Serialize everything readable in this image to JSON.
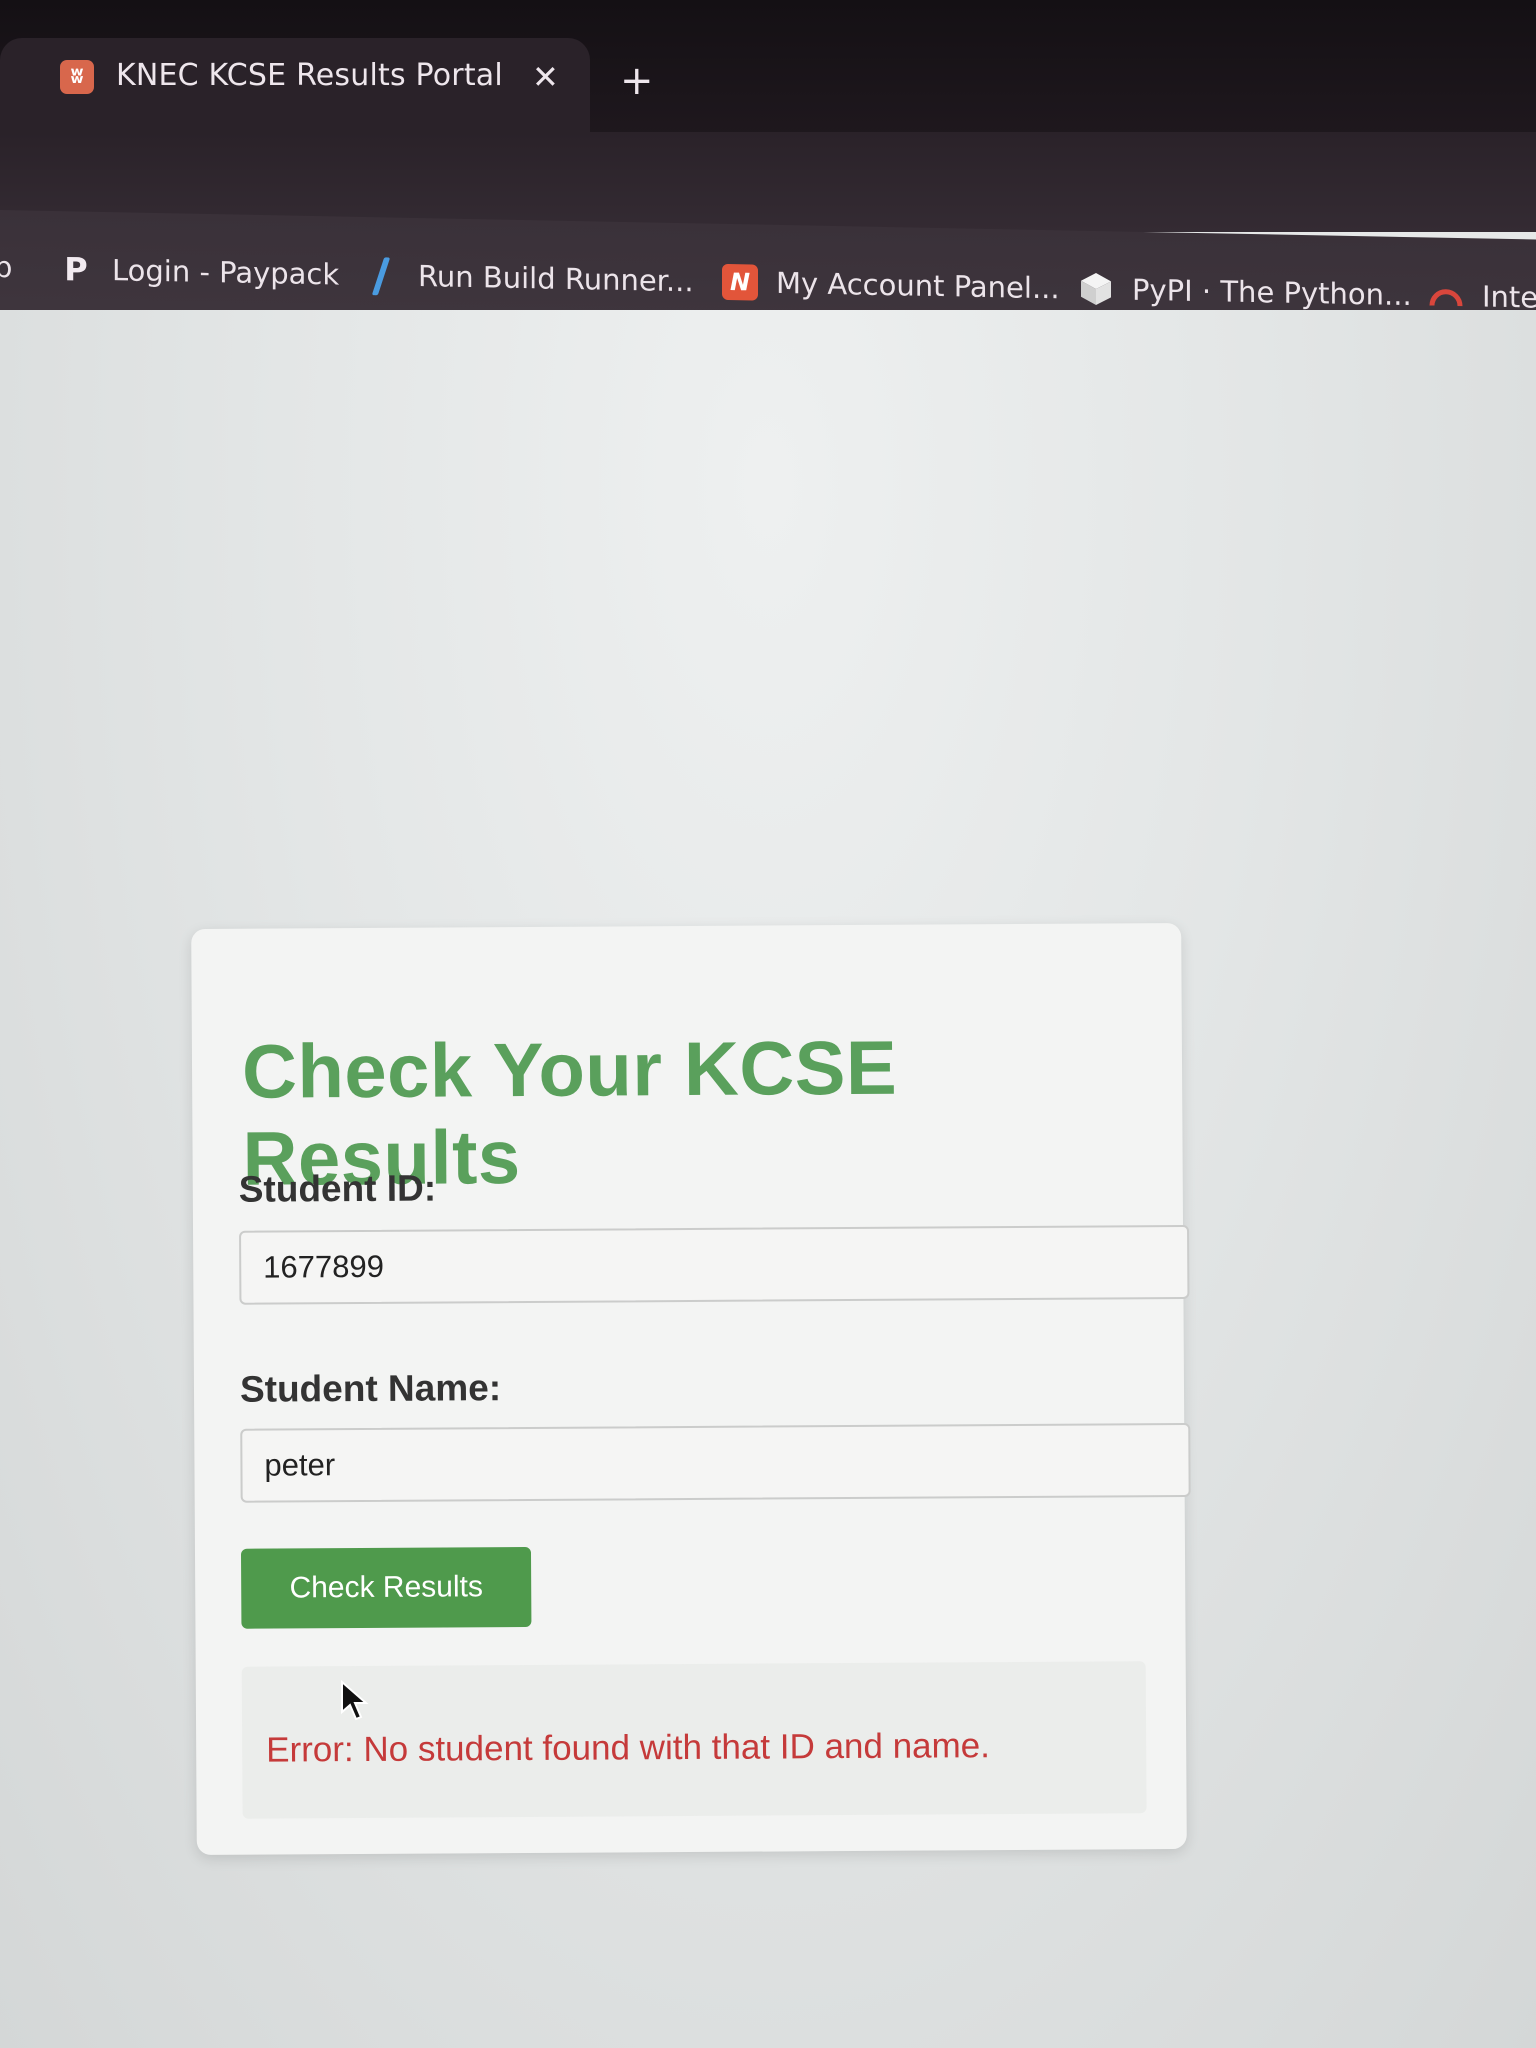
{
  "browser": {
    "tab": {
      "title": "KNEC KCSE Results Portal",
      "close_glyph": "✕",
      "favicon_glyph": "ʬ"
    },
    "new_tab_glyph": "+",
    "bookmarks": [
      {
        "label": "Login - Paypack",
        "icon": "paypack-p-icon",
        "glyph": "P"
      },
      {
        "label": "Run Build Runner...",
        "icon": "slash-icon"
      },
      {
        "label": "My Account Panel...",
        "icon": "n-logo-icon",
        "glyph": "N"
      },
      {
        "label": "PyPI · The Python...",
        "icon": "pypi-cube-icon"
      },
      {
        "label": "Inter",
        "icon": "arc-icon"
      }
    ],
    "partial_left_glyph": "p"
  },
  "form": {
    "title": "Check Your KCSE Results",
    "student_id": {
      "label": "Student ID:",
      "value": "1677899"
    },
    "student_name": {
      "label": "Student Name:",
      "value": "peter"
    },
    "submit_label": "Check Results",
    "error_message": "Error: No student found with that ID and name."
  },
  "colors": {
    "title_green": "#5aa05c",
    "button_green": "#4f9a4c",
    "error_red": "#c53a3a",
    "tab_favicon": "#d8674c"
  }
}
